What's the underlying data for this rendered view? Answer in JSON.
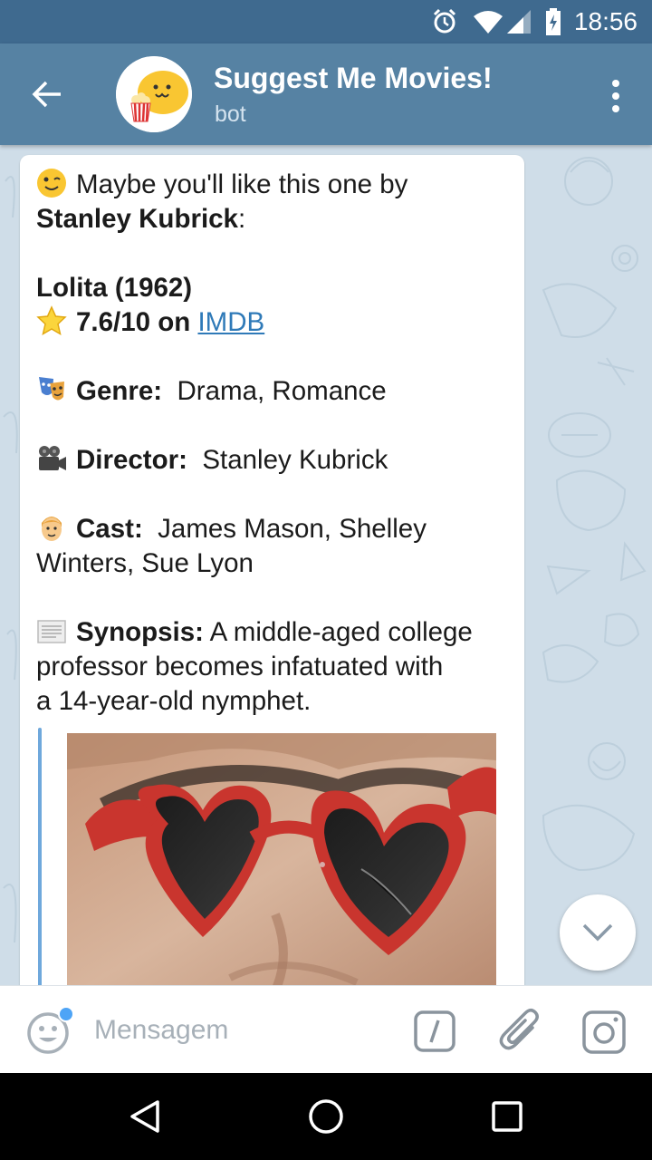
{
  "status_bar": {
    "time": "18:56",
    "icons": [
      "alarm-icon",
      "wifi-icon",
      "signal-icon",
      "battery-charging-icon"
    ]
  },
  "header": {
    "title": "Suggest Me Movies!",
    "subtitle": "bot",
    "background_color": "#5682a3",
    "icons": [
      "back-arrow-icon",
      "bot-avatar-popcorn",
      "more-vert-icon"
    ]
  },
  "message": {
    "intro_text": "Maybe you'll like this one by",
    "director_name": "Stanley Kubrick",
    "intro_suffix": ":",
    "movie_title": "Lolita  (1962)",
    "rating_text": "7.6/10 on ",
    "rating_link": "IMDB",
    "genre_label": "Genre:",
    "genre_value": "Drama,  Romance",
    "director_label": "Director:",
    "director_value": "Stanley Kubrick",
    "cast_label": "Cast:",
    "cast_line1": "James Mason,  Shelley",
    "cast_line2": "Winters,  Sue Lyon",
    "synopsis_label": "Synopsis:",
    "synopsis_line1": "A middle-aged college",
    "synopsis_line2": "professor becomes infatuated with",
    "synopsis_line3": "a 14-year-old nymphet.",
    "icons": [
      "wink-emoji",
      "star-emoji",
      "theater-masks-emoji",
      "movie-camera-emoji",
      "man-emoji",
      "page-emoji"
    ],
    "link_color": "#2f7ab8"
  },
  "preview": {
    "image": "movie-poster-heart-sunglasses"
  },
  "input_bar": {
    "placeholder": "Mensagem",
    "value": "",
    "icons": [
      "emoji-icon",
      "bot-command-icon",
      "attach-icon",
      "camera-icon"
    ],
    "notification_dot_color": "#4ea4f6"
  },
  "nav_bar": {
    "icons": [
      "back-triangle-icon",
      "home-circle-icon",
      "recents-square-icon"
    ]
  },
  "scroll_button": {
    "icon": "chevron-down-icon"
  }
}
